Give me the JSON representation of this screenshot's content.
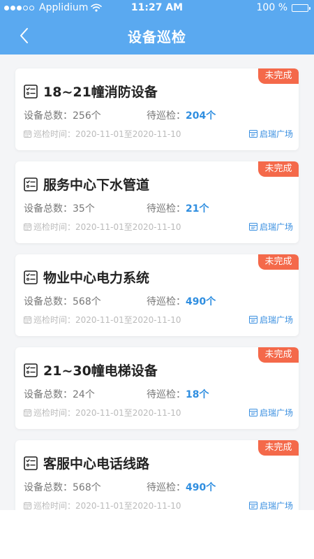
{
  "status_bar": {
    "carrier": "Applidium",
    "time": "11:27 AM",
    "battery_text": "100 %",
    "battery_level": 1.0
  },
  "nav": {
    "title": "设备巡检",
    "back_icon": "chevron-left-icon"
  },
  "labels": {
    "total_prefix": "设备总数：",
    "pending_prefix": "待巡检：",
    "time_prefix": "巡检时间："
  },
  "colors": {
    "header": "#5aa9f0",
    "badge": "#f4694a",
    "accent": "#2f8ee0",
    "background": "#f4f5f7"
  },
  "cards": [
    {
      "status": "未完成",
      "title": "18~21幢消防设备",
      "total": "256个",
      "pending": "204个",
      "time_range": "2020-11-01至2020-11-10",
      "location": "启瑞广场"
    },
    {
      "status": "未完成",
      "title": "服务中心下水管道",
      "total": "35个",
      "pending": "21个",
      "time_range": "2020-11-01至2020-11-10",
      "location": "启瑞广场"
    },
    {
      "status": "未完成",
      "title": "物业中心电力系统",
      "total": "568个",
      "pending": "490个",
      "time_range": "2020-11-01至2020-11-10",
      "location": "启瑞广场"
    },
    {
      "status": "未完成",
      "title": "21~30幢电梯设备",
      "total": "24个",
      "pending": "18个",
      "time_range": "2020-11-01至2020-11-10",
      "location": "启瑞广场"
    },
    {
      "status": "未完成",
      "title": "客服中心电话线路",
      "total": "568个",
      "pending": "490个",
      "time_range": "2020-11-01至2020-11-10",
      "location": "启瑞广场"
    }
  ]
}
